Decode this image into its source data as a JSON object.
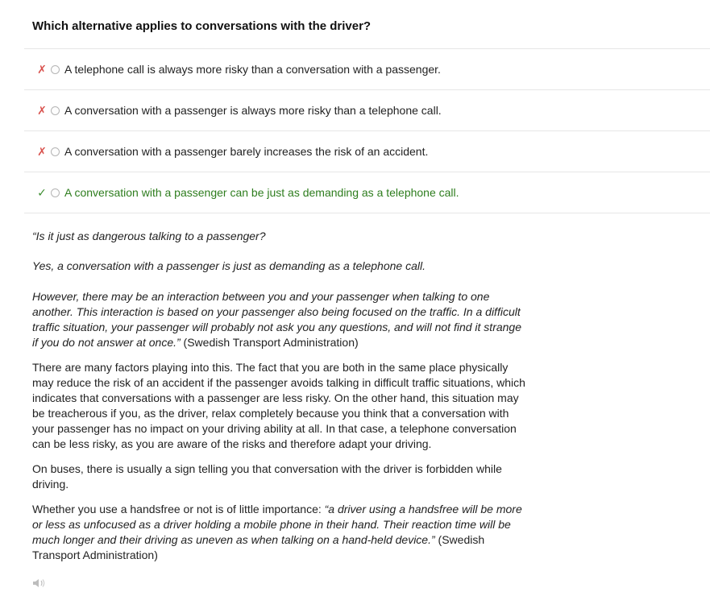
{
  "question": {
    "title": "Which alternative applies to conversations with the driver?"
  },
  "answers": [
    {
      "mark": "✗",
      "status": "wrong",
      "text": "A telephone call is always more risky than a conversation with a passenger."
    },
    {
      "mark": "✗",
      "status": "wrong",
      "text": "A conversation with a passenger is always more risky than a telephone call."
    },
    {
      "mark": "✗",
      "status": "wrong",
      "text": "A conversation with a passenger barely increases the risk of an accident."
    },
    {
      "mark": "✓",
      "status": "correct",
      "text": "A conversation with a passenger can be just as demanding as a telephone call."
    }
  ],
  "colors": {
    "wrong_mark": "#d9534f",
    "correct_mark": "#3c8d2f",
    "correct_text": "#2e7d1e"
  },
  "explanation": {
    "p1": "“Is it just as dangerous talking to a passenger?",
    "p2": "Yes, a conversation with a passenger is just as demanding as a telephone call.",
    "p3_italic": "However, there may be an interaction between you and your passenger when talking to one another. This interaction is based on your passenger also being focused on the traffic. In a difficult traffic situation, your passenger will probably not ask you any questions, and will not find it strange if you do not answer at once.”",
    "p3_source": " (Swedish Transport Administration)",
    "p4": "There are many factors playing into this. The fact that you are both in the same place physically may reduce the risk of an accident if the passenger avoids talking in difficult traffic situations, which indicates that conversations with a passenger are less risky. On the other hand, this situation may be treacherous if you, as the driver, relax completely because you think that a conversation with your passenger has no impact on your driving ability at all. In that case, a telephone conversation can be less risky, as you are aware of the risks and therefore adapt your driving.",
    "p5": "On buses, there is usually a sign telling you that conversation with the driver is forbidden while driving.",
    "p6_lead": "Whether you use a handsfree or not is of little importance: ",
    "p6_italic": "“a driver using a handsfree will be more or less as unfocused as a driver holding a mobile phone in their hand. Their reaction time will be much longer and their driving as uneven as when talking on a hand-held device.”",
    "p6_source": " (Swedish Transport Administration)"
  },
  "icons": {
    "audio": "speaker-icon"
  }
}
